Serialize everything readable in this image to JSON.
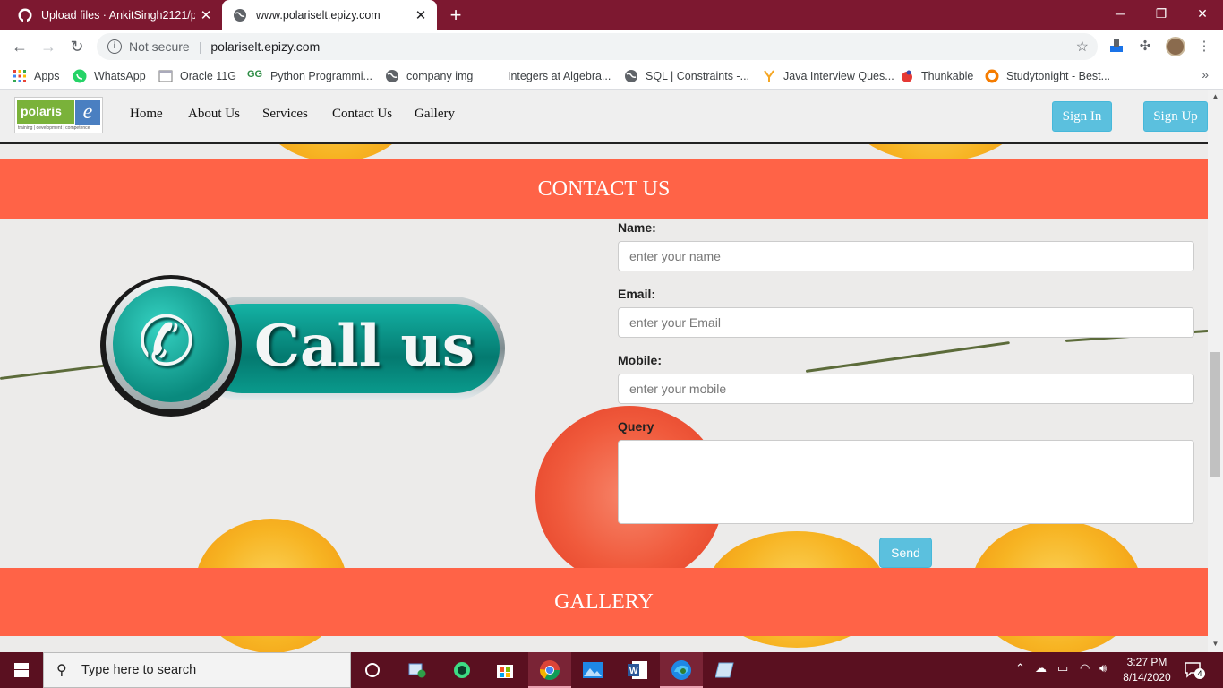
{
  "browser": {
    "tabs": [
      {
        "label": "Upload files · AnkitSingh2121/po",
        "active": false
      },
      {
        "label": "www.polariselt.epizy.com",
        "active": true
      }
    ],
    "new_tab_symbol": "+",
    "close_symbol": "✕",
    "window_controls": {
      "minimize": "─",
      "restore": "❐",
      "close": "✕"
    },
    "security_label": "Not secure",
    "url": "polariselt.epizy.com",
    "bookmarks": [
      {
        "label": "Apps",
        "icon": "apps-grid-icon"
      },
      {
        "label": "WhatsApp",
        "icon": "whatsapp-icon"
      },
      {
        "label": "Oracle 11G",
        "icon": "page-icon"
      },
      {
        "label": "Python Programmi...",
        "icon": "gfg-icon"
      },
      {
        "label": "company img",
        "icon": "globe-icon"
      },
      {
        "label": "Integers at Algebra...",
        "icon": "none"
      },
      {
        "label": "SQL | Constraints -...",
        "icon": "globe-icon"
      },
      {
        "label": "Java Interview Ques...",
        "icon": "javatpoint-icon"
      },
      {
        "label": "Thunkable",
        "icon": "thunkable-icon"
      },
      {
        "label": "Studytonight - Best...",
        "icon": "studytonight-icon"
      }
    ],
    "bookmarks_more": "»"
  },
  "site": {
    "logo_text": "polaris",
    "logo_tagline": "training | development | competence",
    "nav": [
      "Home",
      "About Us",
      "Services",
      "Contact Us",
      "Gallery"
    ],
    "sign_in": "Sign In",
    "sign_up": "Sign Up",
    "contact_heading": "CONTACT US",
    "call_us_text": "Call us",
    "form": {
      "name_label": "Name:",
      "name_placeholder": "enter your name",
      "email_label": "Email:",
      "email_placeholder": "enter your Email",
      "mobile_label": "Mobile:",
      "mobile_placeholder": "enter your mobile",
      "query_label": "Query",
      "send_label": "Send"
    },
    "gallery_heading": "GALLERY",
    "accent_color": "#ff6347",
    "button_color": "#5bc0de"
  },
  "taskbar": {
    "search_placeholder": "Type here to search",
    "time": "3:27 PM",
    "date": "8/14/2020",
    "notification_count": "4"
  }
}
